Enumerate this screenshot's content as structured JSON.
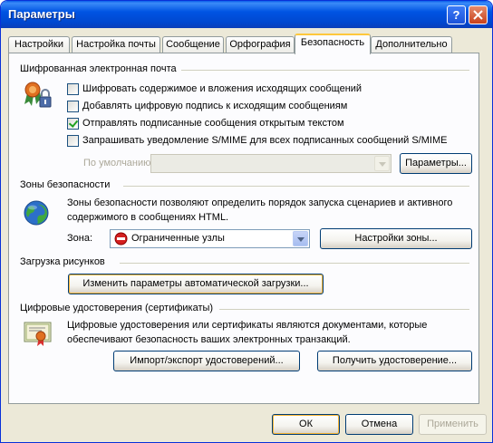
{
  "window": {
    "title": "Параметры",
    "help_button": "?",
    "close_button": "✕"
  },
  "tabs": [
    {
      "label": "Настройки"
    },
    {
      "label": "Настройка почты"
    },
    {
      "label": "Сообщение"
    },
    {
      "label": "Орфография"
    },
    {
      "label": "Безопасность",
      "active": true
    },
    {
      "label": "Дополнительно"
    }
  ],
  "encrypted_mail": {
    "title": "Шифрованная электронная почта",
    "options": [
      {
        "label": "Шифровать содержимое и вложения исходящих сообщений",
        "checked": false
      },
      {
        "label": "Добавлять цифровую подпись к исходящим сообщениям",
        "checked": false
      },
      {
        "label": "Отправлять подписанные сообщения открытым текстом",
        "checked": true
      },
      {
        "label": "Запрашивать уведомление S/MIME для всех подписанных сообщений S/MIME",
        "checked": false
      }
    ],
    "default_label": "По умолчанию:",
    "default_value": "",
    "settings_button": "Параметры..."
  },
  "security_zones": {
    "title": "Зоны безопасности",
    "description_line1": "Зоны безопасности позволяют определить порядок запуска сценариев и активного",
    "description_line2": "содержимого в сообщениях HTML.",
    "zone_label": "Зона:",
    "zone_value": "Ограниченные узлы",
    "zone_settings_button": "Настройки зоны..."
  },
  "image_download": {
    "title": "Загрузка рисунков",
    "change_button": "Изменить параметры автоматической загрузки..."
  },
  "certificates": {
    "title": "Цифровые удостоверения (сертификаты)",
    "description_line1": "Цифровые удостоверения или сертификаты являются документами, которые",
    "description_line2": "обеспечивают безопасность ваших электронных транзакций.",
    "import_export_button": "Импорт/экспорт удостоверений...",
    "get_id_button": "Получить удостоверение..."
  },
  "footer": {
    "ok": "ОК",
    "cancel": "Отмена",
    "apply": "Применить"
  },
  "colors": {
    "titlebar": "#0054E3",
    "dialog_bg": "#ECE9D8",
    "active_tab_accent": "#FFC83C",
    "checkmark": "#21A121"
  }
}
